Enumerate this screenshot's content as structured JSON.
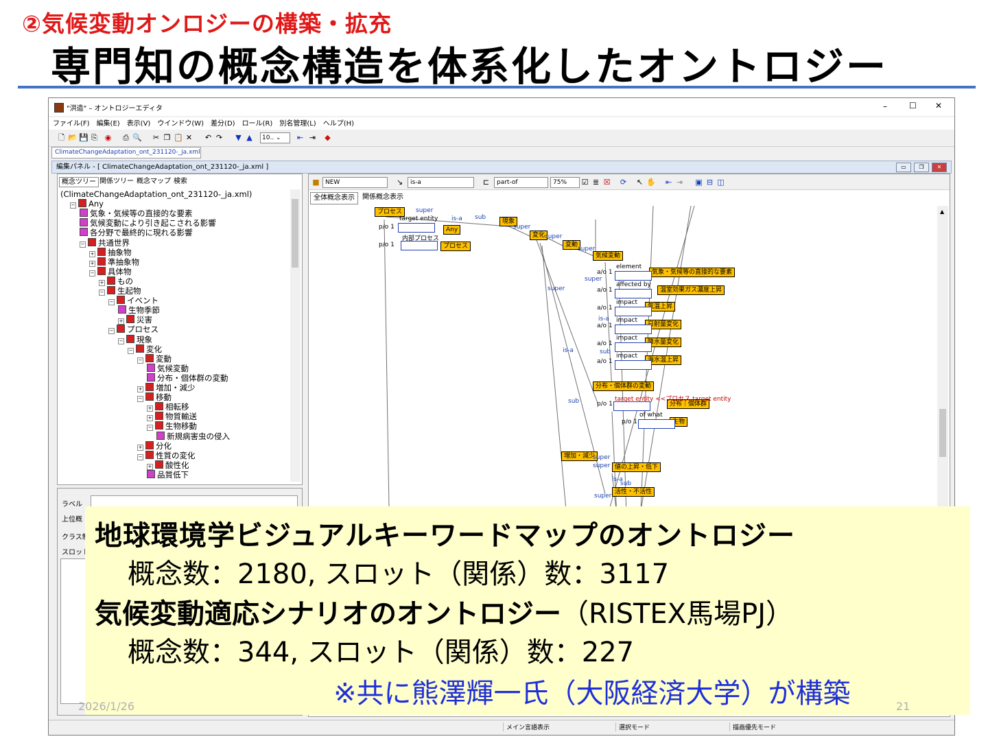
{
  "slide": {
    "subtitle": "②気候変動オンロジーの構築・拡充",
    "title": "専門知の概念構造を体系化したオントロジー",
    "date": "2026/1/26",
    "page": "21"
  },
  "window": {
    "title": "\"洪造\" – オントロジーエディタ",
    "minimize": "–",
    "maximize": "☐",
    "close": "✕",
    "menu": [
      "ファイル(F)",
      "編集(E)",
      "表示(V)",
      "ウインドウ(W)",
      "差分(D)",
      "ロール(R)",
      "別名管理(L)",
      "ヘルプ(H)"
    ],
    "zoom_combo": "10..",
    "doc_tab": "ClimateChangeAdaptation_ont_231120-_ja.xml",
    "panel_title": "編集パネル - [ ClimateChangeAdaptation_ont_231120-_ja.xml ]"
  },
  "left_tabs": [
    "概念ツリー",
    "関係ツリー",
    "概念マップ",
    "検索"
  ],
  "tree": [
    {
      "text": "(ClimateChangeAdaptation_ont_231120-_ja.xml)",
      "indent": 0,
      "icon": "none",
      "tog": ""
    },
    {
      "text": "Any",
      "indent": 1,
      "icon": "red",
      "tog": "−"
    },
    {
      "text": "気象・気候等の直接的な要素",
      "indent": 2,
      "icon": "mag",
      "tog": ""
    },
    {
      "text": "気候変動により引き起こされる影響",
      "indent": 2,
      "icon": "mag",
      "tog": ""
    },
    {
      "text": "各分野で最終的に現れる影響",
      "indent": 2,
      "icon": "mag",
      "tog": ""
    },
    {
      "text": "共通世界",
      "indent": 2,
      "icon": "red",
      "tog": "−"
    },
    {
      "text": "抽象物",
      "indent": 3,
      "icon": "red",
      "tog": "+"
    },
    {
      "text": "準抽象物",
      "indent": 3,
      "icon": "red",
      "tog": "+"
    },
    {
      "text": "具体物",
      "indent": 3,
      "icon": "red",
      "tog": "−"
    },
    {
      "text": "もの",
      "indent": 4,
      "icon": "red",
      "tog": "+"
    },
    {
      "text": "生起物",
      "indent": 4,
      "icon": "red",
      "tog": "−"
    },
    {
      "text": "イベント",
      "indent": 5,
      "icon": "red",
      "tog": "−"
    },
    {
      "text": "生物季節",
      "indent": 6,
      "icon": "mag",
      "tog": ""
    },
    {
      "text": "災害",
      "indent": 6,
      "icon": "red",
      "tog": "+"
    },
    {
      "text": "プロセス",
      "indent": 5,
      "icon": "red",
      "tog": "−"
    },
    {
      "text": "現象",
      "indent": 6,
      "icon": "red",
      "tog": "−"
    },
    {
      "text": "変化",
      "indent": 7,
      "icon": "red",
      "tog": "−"
    },
    {
      "text": "変動",
      "indent": 8,
      "icon": "red",
      "tog": "−"
    },
    {
      "text": "気候変動",
      "indent": 9,
      "icon": "mag",
      "tog": ""
    },
    {
      "text": "分布・個体群の変動",
      "indent": 9,
      "icon": "mag",
      "tog": ""
    },
    {
      "text": "増加・減少",
      "indent": 8,
      "icon": "red",
      "tog": "+"
    },
    {
      "text": "移動",
      "indent": 8,
      "icon": "red",
      "tog": "−"
    },
    {
      "text": "相転移",
      "indent": 9,
      "icon": "red",
      "tog": "+"
    },
    {
      "text": "物質輸送",
      "indent": 9,
      "icon": "red",
      "tog": "+"
    },
    {
      "text": "生物移動",
      "indent": 9,
      "icon": "red",
      "tog": "−"
    },
    {
      "text": "新規病害虫の侵入",
      "indent": 10,
      "icon": "mag",
      "tog": ""
    },
    {
      "text": "分化",
      "indent": 8,
      "icon": "red",
      "tog": "+"
    },
    {
      "text": "性質の変化",
      "indent": 8,
      "icon": "red",
      "tog": "−"
    },
    {
      "text": "酸性化",
      "indent": 9,
      "icon": "red",
      "tog": "+"
    },
    {
      "text": "品質低下",
      "indent": 9,
      "icon": "mag",
      "tog": ""
    }
  ],
  "props": {
    "label": "ラベル",
    "super": "上位概",
    "class": "クラス制",
    "slot": "スロット"
  },
  "right_toolbar": {
    "combo1": "NEW",
    "combo2": "is-a",
    "combo3": "part-of",
    "combo4": "75%"
  },
  "right_tabs": [
    "全体概念表示",
    "関係概念表示"
  ],
  "graph": {
    "nodes": [
      {
        "text": "プロセス"
      },
      {
        "text": "Any"
      },
      {
        "text": "プロセス"
      },
      {
        "text": "現象"
      },
      {
        "text": "変化"
      },
      {
        "text": "変動"
      },
      {
        "text": "気候変動"
      },
      {
        "text": "気象・気候等の直接的な要素"
      },
      {
        "text": "温室効果ガス濃度上昇"
      },
      {
        "text": "気温上昇"
      },
      {
        "text": "日射量変化"
      },
      {
        "text": "降水量変化"
      },
      {
        "text": "海水温上昇"
      },
      {
        "text": "分布・個体群の変動"
      },
      {
        "text": "分布｜個体群"
      },
      {
        "text": "生物"
      },
      {
        "text": "増加・減少"
      },
      {
        "text": "値の上昇・低下"
      },
      {
        "text": "活性・不活性"
      }
    ],
    "slot_labels": [
      "target entity",
      "内部プロセス",
      "element",
      "affected by",
      "impact",
      "impact",
      "impact",
      "impact",
      "target entity <<プロセス.target entity",
      "of what"
    ],
    "cardinalities": [
      "p/o 1",
      "p/o 1",
      "a/o 1",
      "a/o 1",
      "a/o 1",
      "a/o 1",
      "a/o 1",
      "a/o 1",
      "p/o 1",
      "p/o 1"
    ],
    "edge_labels": [
      "super",
      "is-a",
      "sub",
      "super",
      "super",
      "super",
      "super",
      "super",
      "is-a",
      "sub",
      "is-a",
      "sub",
      "super",
      "super",
      "is-a",
      "sub",
      "super"
    ]
  },
  "status": [
    "メイン言語表示",
    "選択モード",
    "描画優先モード"
  ],
  "info": {
    "line1_bold": "地球環境学ビジュアルキーワードマップのオントロジー",
    "line2": "概念数：2180,  スロット（関係）数：3117",
    "line3_bold": "気候変動適応シナリオのオントロジー",
    "line3_rest": "（RISTEX馬場PJ）",
    "line4": "概念数：344,  スロット（関係）数：227",
    "line5": "※共に熊澤輝一氏（大阪経済大学）が構築",
    "line5_color": "#1f2fd8"
  }
}
